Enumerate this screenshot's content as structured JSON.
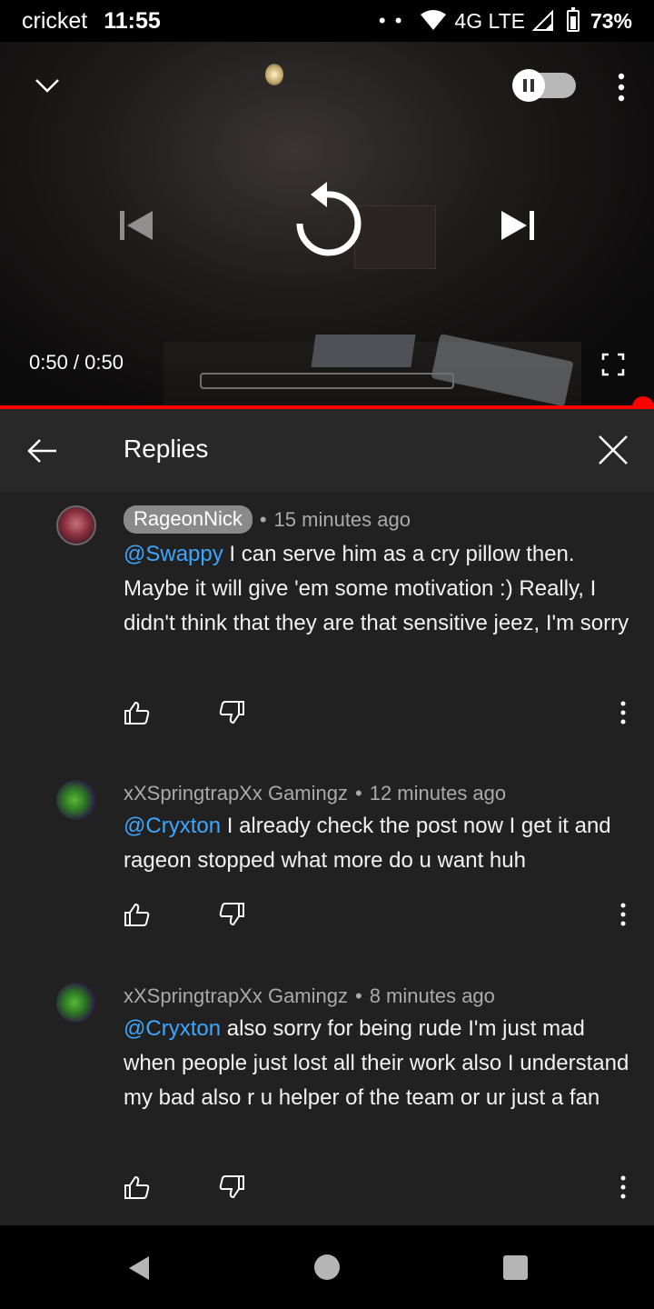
{
  "status_bar": {
    "carrier": "cricket",
    "time": "11:55",
    "network": "4G LTE",
    "battery": "73%"
  },
  "video": {
    "time_display": "0:50 / 0:50",
    "progress": 1.0,
    "autoplay_state": "paused"
  },
  "replies": {
    "title": "Replies",
    "comments": [
      {
        "author": "RageonNick",
        "time": "15 minutes ago",
        "mention": "@Swappy",
        "text": " I can serve him as a cry pillow then. Maybe it will give 'em some motivation :) Really, I didn't think that they are that sensitive jeez, I'm sorry"
      },
      {
        "author": "xXSpringtrapXx Gamingz",
        "time": "12 minutes ago",
        "mention": "@Cryxton",
        "text": " I already check the post now I get it and rageon stopped what more do u want huh"
      },
      {
        "author": "xXSpringtrapXx Gamingz",
        "time": "8 minutes ago",
        "mention": "@Cryxton",
        "text": " also sorry for being rude I'm just mad when people just lost all their work also I understand my bad also r u helper of the team or ur just  a fan"
      }
    ]
  },
  "colors": {
    "accent": "#ff0000",
    "mention": "#3ea6ff",
    "panel_bg": "#212121",
    "header_bg": "#282828"
  },
  "icons": {
    "back": "arrow-left-icon",
    "close": "close-icon",
    "like": "thumbs-up-icon",
    "dislike": "thumbs-down-icon",
    "more": "more-vert-icon"
  }
}
